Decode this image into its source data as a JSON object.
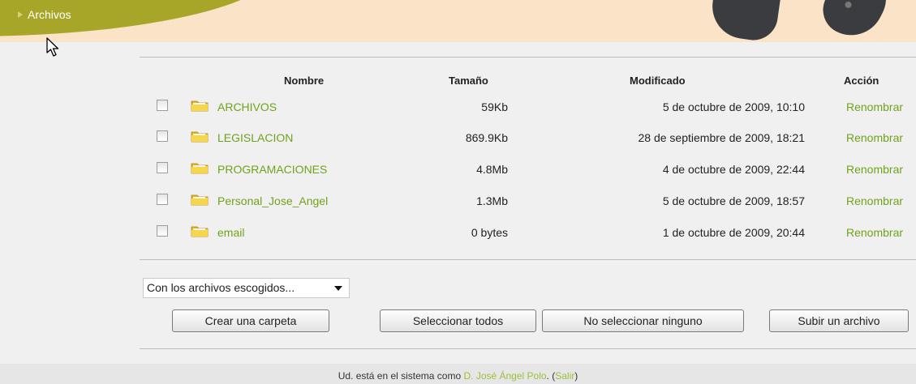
{
  "breadcrumb": {
    "label": "Archivos"
  },
  "table": {
    "headers": {
      "name": "Nombre",
      "size": "Tamaño",
      "modified": "Modificado",
      "action": "Acción"
    },
    "rows": [
      {
        "name": "ARCHIVOS",
        "size": "59Kb",
        "modified": "5 de octubre de 2009, 10:10",
        "action": "Renombrar"
      },
      {
        "name": "LEGISLACION",
        "size": "869.9Kb",
        "modified": "28 de septiembre de 2009, 18:21",
        "action": "Renombrar"
      },
      {
        "name": "PROGRAMACIONES",
        "size": "4.8Mb",
        "modified": "4 de octubre de 2009, 22:44",
        "action": "Renombrar"
      },
      {
        "name": "Personal_Jose_Angel",
        "size": "1.3Mb",
        "modified": "5 de octubre de 2009, 18:57",
        "action": "Renombrar"
      },
      {
        "name": "email",
        "size": "0 bytes",
        "modified": "1 de octubre de 2009, 20:44",
        "action": "Renombrar"
      }
    ]
  },
  "bulk_select": {
    "selected": "Con los archivos escogidos..."
  },
  "buttons": {
    "create_folder": "Crear una carpeta",
    "select_all": "Seleccionar todos",
    "select_none": "No seleccionar ninguno",
    "upload": "Subir un archivo"
  },
  "footer": {
    "prefix": "Ud. está en el sistema como ",
    "user": "D. José Ángel Polo",
    "sep": ". (",
    "logout": "Salir",
    "suffix": ")"
  },
  "colors": {
    "link": "#70a31b",
    "banner_bg": "#fbe3c7",
    "swoosh": "#a7a628"
  },
  "icons": {
    "folder": "folder-icon",
    "cursor": "mouse-pointer-icon"
  }
}
